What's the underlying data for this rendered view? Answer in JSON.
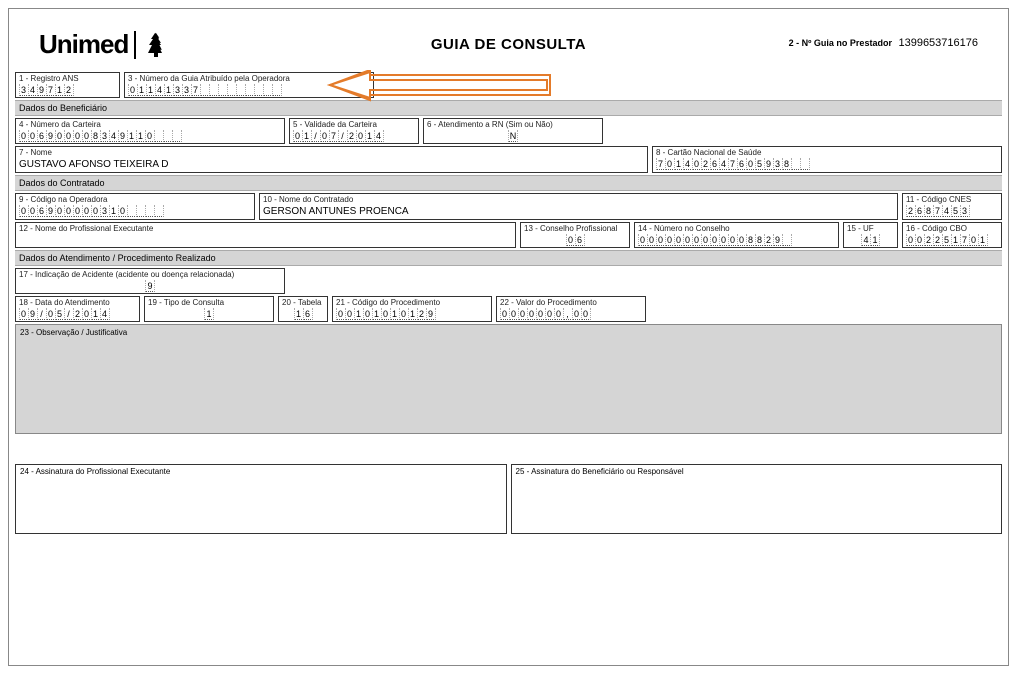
{
  "header": {
    "logo_text": "Unimed",
    "title": "GUIA DE CONSULTA",
    "field2_label": "2 - Nº Guia no Prestador",
    "field2_value": "1399653716176"
  },
  "row1": {
    "f1_label": "1 - Registro ANS",
    "f1_value": "349712",
    "f3_label": "3 - Número da Guia Atribuído pela Operadora",
    "f3_value": "01141337         "
  },
  "sec_beneficiario": "Dados do Beneficiário",
  "row2": {
    "f4_label": "4 - Número da Carteira",
    "f4_value": "006900008349110   ",
    "f5_label": "5 - Validade da Carteira",
    "f5_value": "01/07/2014",
    "f6_label": "6 - Atendimento a RN (Sim ou Não)",
    "f6_value": "N"
  },
  "row3": {
    "f7_label": "7 - Nome",
    "f7_value": "GUSTAVO AFONSO TEIXEIRA D",
    "f8_label": "8 - Cartão Nacional de Saúde",
    "f8_value": "701402647605938  "
  },
  "sec_contratado": "Dados do Contratado",
  "row4": {
    "f9_label": "9 - Código na Operadora",
    "f9_value": "006900000310    ",
    "f10_label": "10 - Nome do Contratado",
    "f10_value": "GERSON ANTUNES PROENCA",
    "f11_label": "11 - Código CNES",
    "f11_value": "2687453"
  },
  "row5": {
    "f12_label": "12 - Nome do Profissional Executante",
    "f12_value": "",
    "f13_label": "13 - Conselho Profissional",
    "f13_value": "06",
    "f14_label": "14 - Número no Conselho",
    "f14_value": "0000000000008829 ",
    "f15_label": "15 - UF",
    "f15_value": "41",
    "f16_label": "16 - Código CBO",
    "f16_value": "002251701"
  },
  "sec_atendimento": "Dados do Atendimento / Procedimento Realizado",
  "row6": {
    "f17_label": "17 - Indicação de Acidente (acidente ou doença relacionada)",
    "f17_value": "9"
  },
  "row7": {
    "f18_label": "18 - Data do Atendimento",
    "f18_value": "09/05/2014",
    "f19_label": "19 - Tipo de Consulta",
    "f19_value": "1",
    "f20_label": "20 - Tabela",
    "f20_value": "16",
    "f21_label": "21 - Código do Procedimento",
    "f21_value": "00101010129",
    "f22_label": "22 - Valor do Procedimento",
    "f22_value": "0000000,00"
  },
  "obs": {
    "f23_label": "23 - Observação / Justificativa"
  },
  "sig": {
    "f24_label": "24 - Assinatura do Profissional Executante",
    "f25_label": "25 - Assinatura do Beneficiário ou Responsável"
  }
}
